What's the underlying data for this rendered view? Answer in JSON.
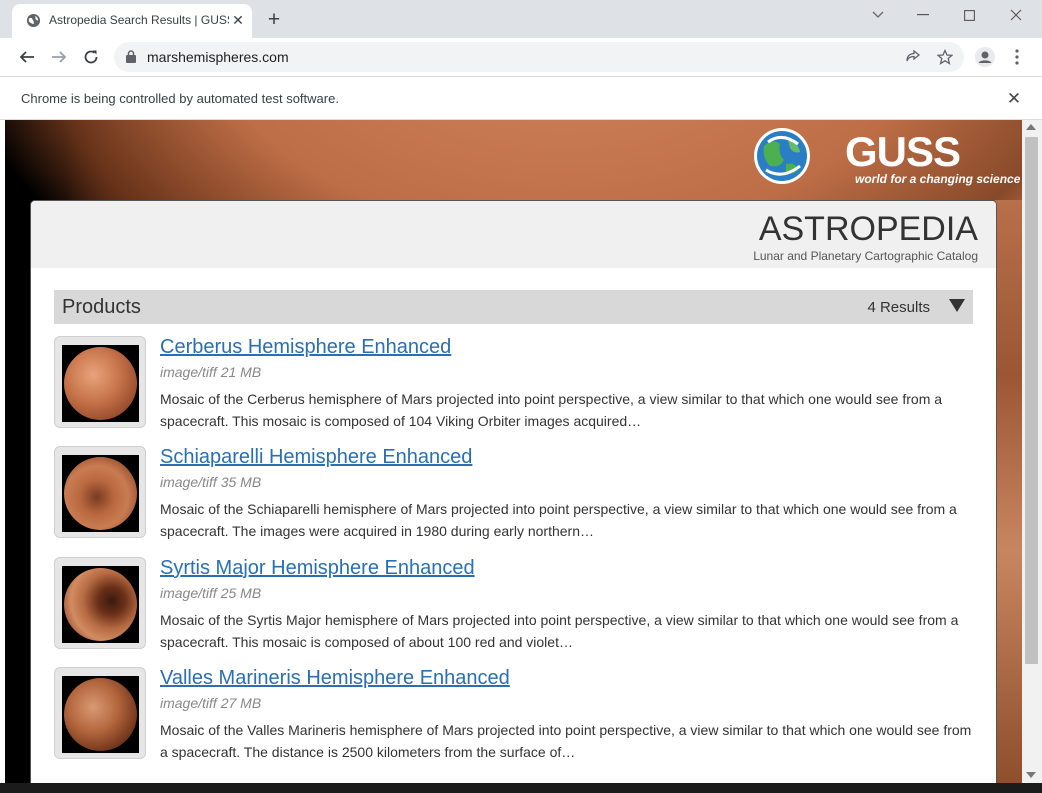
{
  "browser": {
    "tab_title": "Astropedia Search Results | GUSS",
    "url": "marshemispheres.com",
    "infobar_text": "Chrome is being controlled by automated test software."
  },
  "site": {
    "guss_logo_text": "GUSS",
    "guss_tagline": "world for a changing science",
    "astropedia_logo": "ASTROPEDIA",
    "astropedia_subtitle": "Lunar and Planetary Cartographic Catalog"
  },
  "products": {
    "heading": "Products",
    "results_count": "4 Results",
    "items": [
      {
        "title": "Cerberus Hemisphere Enhanced",
        "meta": "image/tiff 21 MB",
        "description": "Mosaic of the Cerberus hemisphere of Mars projected into point perspective, a view similar to that which one would see from a spacecraft. This mosaic is composed of 104 Viking Orbiter images acquired…"
      },
      {
        "title": "Schiaparelli Hemisphere Enhanced",
        "meta": "image/tiff 35 MB",
        "description": "Mosaic of the Schiaparelli hemisphere of Mars projected into point perspective, a view similar to that which one would see from a spacecraft. The images were acquired in 1980 during early northern…"
      },
      {
        "title": "Syrtis Major Hemisphere Enhanced",
        "meta": "image/tiff 25 MB",
        "description": "Mosaic of the Syrtis Major hemisphere of Mars projected into point perspective, a view similar to that which one would see from a spacecraft. This mosaic is composed of about 100 red and violet…"
      },
      {
        "title": "Valles Marineris Hemisphere Enhanced",
        "meta": "image/tiff 27 MB",
        "description": "Mosaic of the Valles Marineris hemisphere of Mars projected into point perspective, a view similar to that which one would see from a spacecraft. The distance is 2500 kilometers from the surface of…"
      }
    ]
  },
  "colors": {
    "link": "#2a6fb3",
    "tab_strip": "#dee1e6",
    "products_bar": "#d8d8d8"
  }
}
